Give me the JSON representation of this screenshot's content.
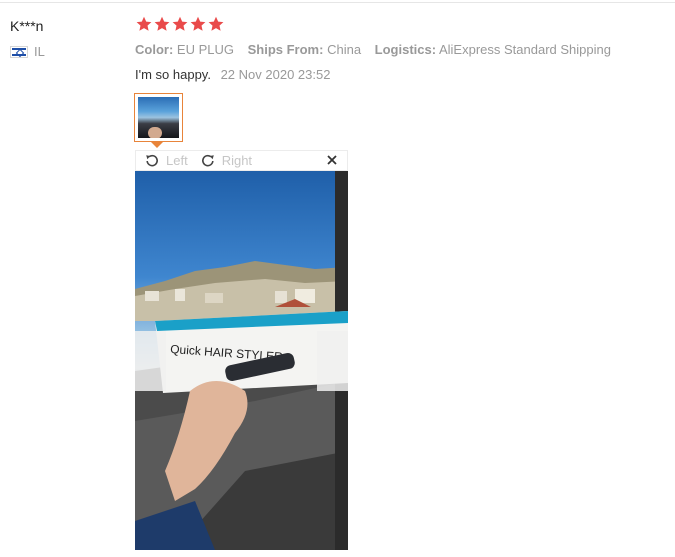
{
  "review": {
    "user_name": "K***n",
    "country_code": "IL",
    "rating": 5,
    "attributes": [
      {
        "key": "Color:",
        "value": "EU PLUG"
      },
      {
        "key": "Ships From:",
        "value": "China"
      },
      {
        "key": "Logistics:",
        "value": "AliExpress Standard Shipping"
      }
    ],
    "text": "I'm so happy.",
    "date": "22 Nov 2020 23:52"
  },
  "viewer": {
    "rotate_left_label": "Left",
    "rotate_right_label": "Right",
    "photo_text": "Quick HAIR STYLER"
  },
  "colors": {
    "star": "#e94a4a",
    "accent": "#e8843a",
    "muted": "#999999"
  },
  "icons": [
    "israel-flag-icon",
    "star-icon",
    "rotate-left-icon",
    "rotate-right-icon",
    "close-icon"
  ]
}
